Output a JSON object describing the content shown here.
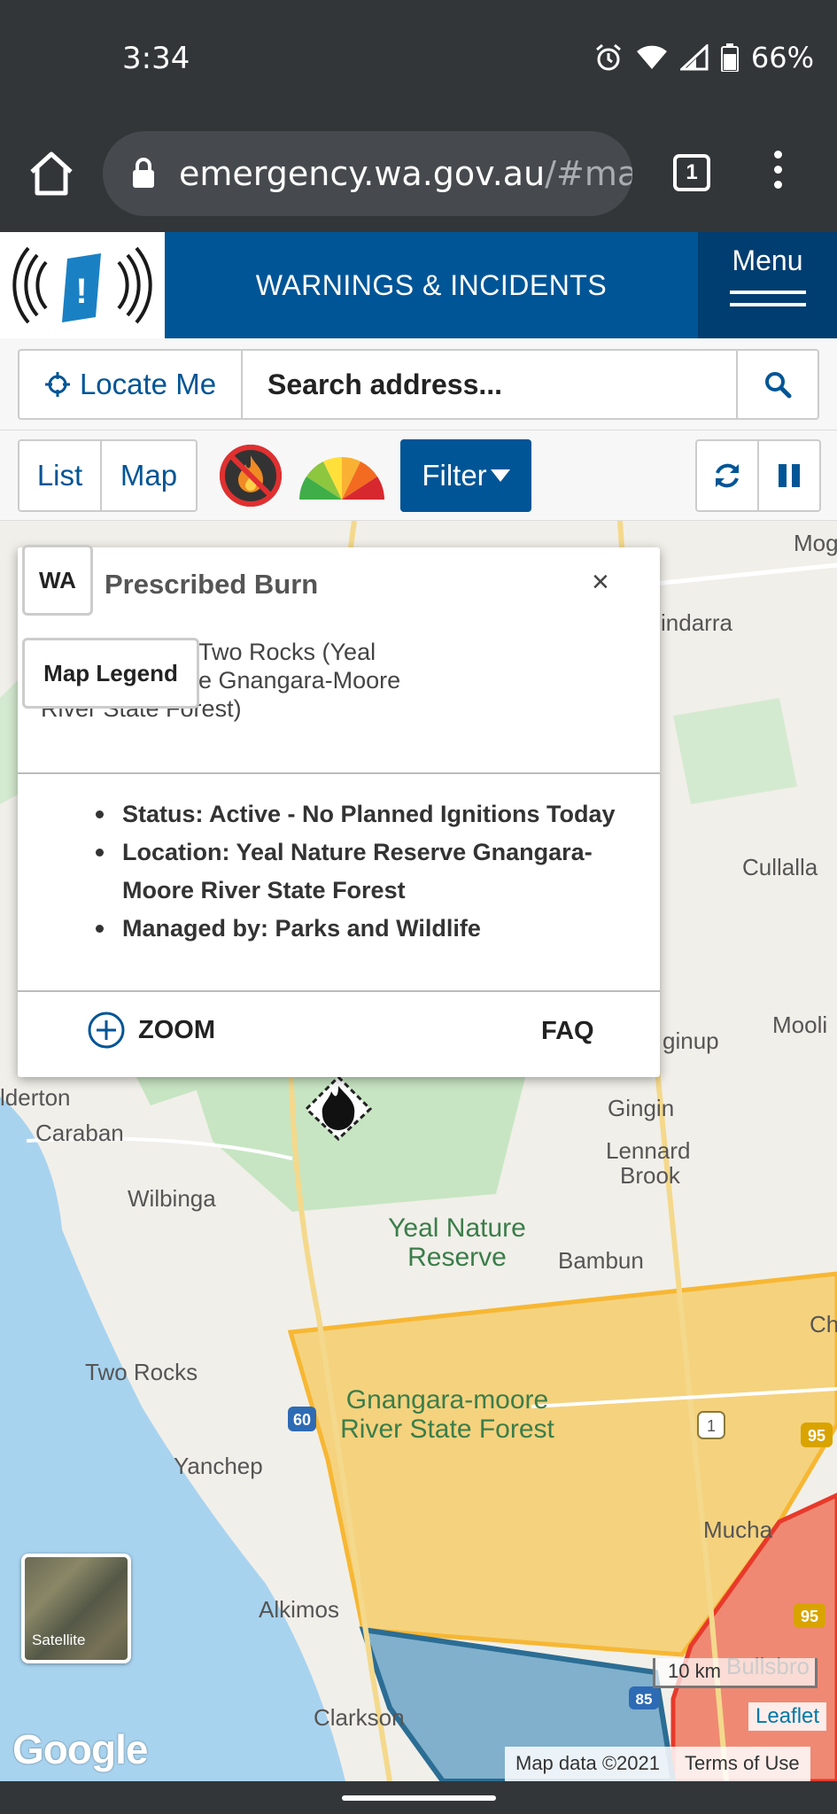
{
  "status_bar": {
    "time": "3:34",
    "battery": "66%"
  },
  "browser": {
    "url_host": "emergency.wa.gov.au",
    "url_path": "/#map/",
    "tab_count": "1"
  },
  "header": {
    "title": "WARNINGS & INCIDENTS",
    "menu_label": "Menu"
  },
  "search": {
    "locate_label": "Locate Me",
    "placeholder": "Search address..."
  },
  "toolbar": {
    "list_label": "List",
    "map_label": "Map",
    "filter_label": "Filter"
  },
  "map": {
    "labels": [
      "Mog",
      "indarra",
      "Cullalla",
      "Mooli",
      "lderton",
      "Caraban",
      "ginup",
      "Gingin",
      "Lennard",
      "Brook",
      "Wilbinga",
      "Bambun",
      "Ch",
      "Two Rocks",
      "Yanchep",
      "Alkimos",
      "Clarkson",
      "Mucha",
      "Bullsbro"
    ],
    "park_labels": {
      "yeal": "Yeal Nature Reserve",
      "gnangara": "Gnangara-moore River State Forest"
    },
    "road_shields": [
      "60",
      "1",
      "95",
      "95",
      "85"
    ],
    "satellite_label": "Satellite",
    "google_logo": "Google",
    "scale": "10 km",
    "leaflet": "Leaflet",
    "map_data": "Map data ©2021",
    "terms": "Terms of Use",
    "colors": {
      "orange_zone": "#f5c85a",
      "red_zone": "#ef6f55",
      "blue_zone": "#5b9bc2",
      "water": "#a8d3ef",
      "park": "#c7e5c2"
    }
  },
  "popup": {
    "badge": "WA",
    "legend_label": "Map Legend",
    "title": "Prescribed Burn",
    "subtitle_line1": "Two Rocks (Yeal",
    "subtitle_line2": "e Gnangara-Moore",
    "subtitle_line3": "River State Forest)",
    "close": "×",
    "details": [
      "Status: Active - No Planned Ignitions Today",
      "Location: Yeal Nature Reserve Gnangara-Moore River State Forest",
      "Managed by: Parks and Wildlife"
    ],
    "zoom_label": "ZOOM",
    "faq_label": "FAQ"
  }
}
